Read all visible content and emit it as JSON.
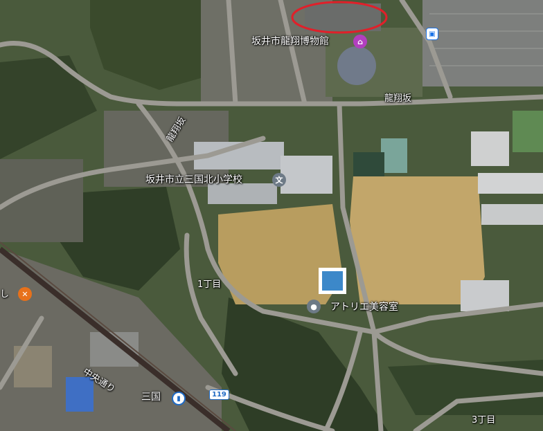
{
  "map": {
    "labels": {
      "museum": "坂井市龍翔博物館",
      "road_ryushozaka_top": "龍翔坂",
      "road_ryushozaka_left": "龍翔坂",
      "school": "坂井市立三国北小学校",
      "chome1": "1丁目",
      "salon": "アトリエ美容室",
      "chuo_dori": "中央通り",
      "station": "三国",
      "chome3": "3丁目",
      "route_number": "119",
      "food_partial": "し"
    },
    "icons": {
      "museum": "museum-icon",
      "school": "school-icon",
      "salon": "place-icon",
      "food": "restaurant-icon",
      "bus": "bus-stop-icon",
      "station": "train-station-icon"
    },
    "colors": {
      "annotation_circle": "#e0202a",
      "museum_pin": "#b23fbf",
      "food_pin": "#e7711b",
      "transit": "#1f6ac4"
    }
  }
}
